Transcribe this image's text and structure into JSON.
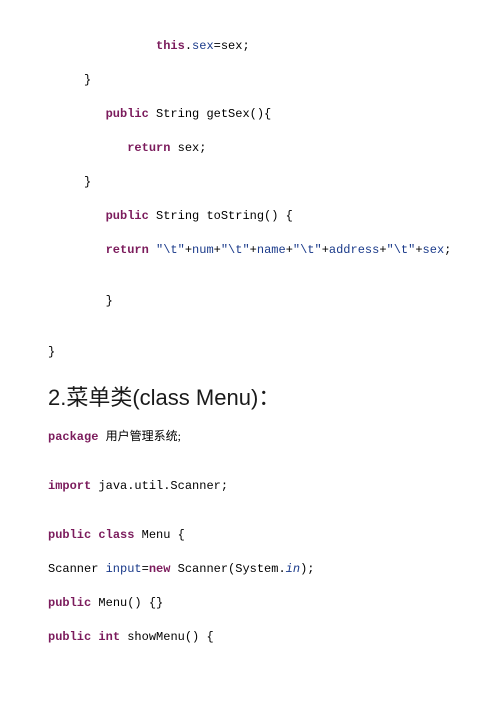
{
  "block1": {
    "l1_indent": "               ",
    "l1_a": "this",
    "l1_b": ".",
    "l1_c": "sex",
    "l1_d": "=sex;",
    "l2_indent": "     ",
    "l2": "}",
    "l3_indent": "        ",
    "l3_a": "public",
    "l3_b": " String getSex(){",
    "l4_indent": "           ",
    "l4_a": "return",
    "l4_b": " sex;",
    "l5_indent": "     ",
    "l5": "}",
    "l6_indent": "        ",
    "l6_a": "public",
    "l6_b": " String toString() {",
    "l7_indent": "        ",
    "l7_a": "return",
    "l7_b": " ",
    "l7_s1": "\"\\t\"",
    "l7_p1": "+",
    "l7_v1": "num",
    "l7_p2": "+",
    "l7_s2": "\"\\t\"",
    "l7_p3": "+",
    "l7_v2": "name",
    "l7_p4": "+",
    "l7_s3": "\"\\t\"",
    "l7_p5": "+",
    "l7_v3": "address",
    "l7_p6": "+",
    "l7_s4": "\"\\t\"",
    "l7_p7": "+",
    "l7_v4": "sex",
    "l7_end": ";",
    "l8_indent": "        ",
    "l8": "}",
    "l9": "}"
  },
  "heading": "2.菜单类(class Menu)：",
  "block2": {
    "l1_a": "package",
    "l1_b": " ",
    "l1_c": "用户管理系统;",
    "l2_a": "import",
    "l2_b": " java.util.Scanner;",
    "l3_a": "public",
    "l3_b": " ",
    "l3_c": "class",
    "l3_d": " Menu {",
    "l4_a": "Scanner ",
    "l4_b": "input",
    "l4_c": "=",
    "l4_d": "new",
    "l4_e": " Scanner(System.",
    "l4_f": "in",
    "l4_g": ");",
    "l5_a": "public",
    "l5_b": " Menu() {}",
    "l6_a": "public",
    "l6_b": " ",
    "l6_c": "int",
    "l6_d": " showMenu() {"
  }
}
